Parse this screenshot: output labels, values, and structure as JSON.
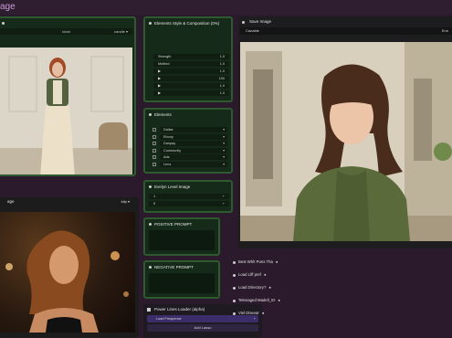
{
  "app": {
    "title": "age"
  },
  "node_image1": {
    "header": "",
    "bar_center": "Idoln",
    "bar_right": "candle ▾"
  },
  "node_image2": {
    "header": "age",
    "bar_right": "ldlp ▾"
  },
  "node_styles": {
    "title": "Elements Style & Composition (0%)",
    "rows": [
      {
        "label": "Strength",
        "value": "1.0"
      },
      {
        "label": "Mottled",
        "value": "1.0"
      },
      {
        "label": "▶",
        "value": "1.0"
      },
      {
        "label": "▶",
        "value": "100"
      },
      {
        "label": "▶",
        "value": "1.0"
      },
      {
        "label": "▶",
        "value": "1.0"
      }
    ]
  },
  "node_elements": {
    "title": "Elements",
    "rows": [
      "Dallas",
      "Ebony",
      "Danpay",
      "Community",
      "Ads",
      "Lens"
    ]
  },
  "node_level": {
    "title": "Evelyn Level Image",
    "rows": [
      {
        "value": "1"
      },
      {
        "value": "5"
      }
    ]
  },
  "node_positive": {
    "title": "POSITIVE PROMPT"
  },
  "node_negative": {
    "title": "NEGATIVE PROMPT"
  },
  "node_loader": {
    "title": "Power Lines Loader (alpha)",
    "row_label": "Load Frequence",
    "add_button": "Add Lasso"
  },
  "node_save": {
    "title": "Save Image",
    "bar_left": "Canable",
    "bar_right": "Enn"
  },
  "options": [
    {
      "label": "Best Whlt Pons Tha",
      "value": "●"
    },
    {
      "label": "Load Llff pref",
      "value": "●"
    },
    {
      "label": "Load Directory?",
      "value": "●"
    },
    {
      "label": "Telenaged Madell_ID",
      "value": "●"
    },
    {
      "label": "Viel Disevar",
      "value": "●"
    }
  ],
  "colors": {
    "background": "#2a1a2b",
    "node_green": "#152a18",
    "node_border": "#2f5a2f",
    "accent_purple": "#c89ad6"
  }
}
